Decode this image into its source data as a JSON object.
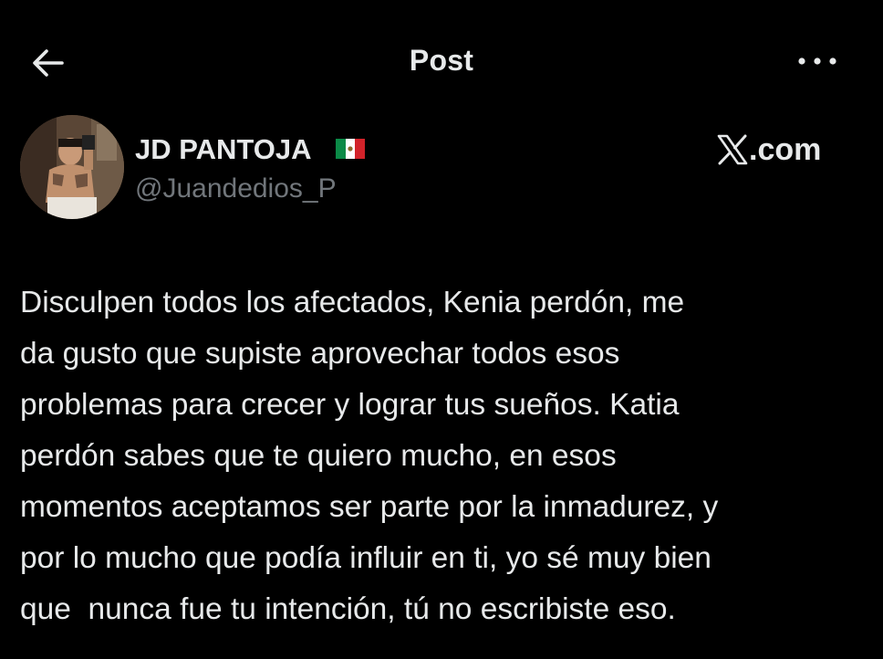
{
  "header": {
    "title": "Post",
    "back_icon": "arrow-left-icon",
    "more_icon": "more-horizontal-icon"
  },
  "author": {
    "display_name": "JD PANTOJA",
    "flag_icon": "mexico-flag-icon",
    "handle": "@Juandedios_P"
  },
  "brand": {
    "text": ".com",
    "icon": "x-logo-icon"
  },
  "post": {
    "lines": [
      "Disculpen todos los afectados, Kenia perdón, me",
      "da gusto que supiste aprovechar todos esos",
      "problemas para crecer y lograr tus sueños. Katia",
      "perdón sabes que te quiero mucho, en esos",
      "momentos aceptamos ser parte por la inmadurez, y",
      "por lo mucho que podía influir en ti, yo sé muy bien",
      "que  nunca fue tu intención, tú no escribiste eso."
    ]
  },
  "colors": {
    "background": "#000000",
    "text_primary": "#e7e9ea",
    "text_secondary": "#71767b"
  }
}
